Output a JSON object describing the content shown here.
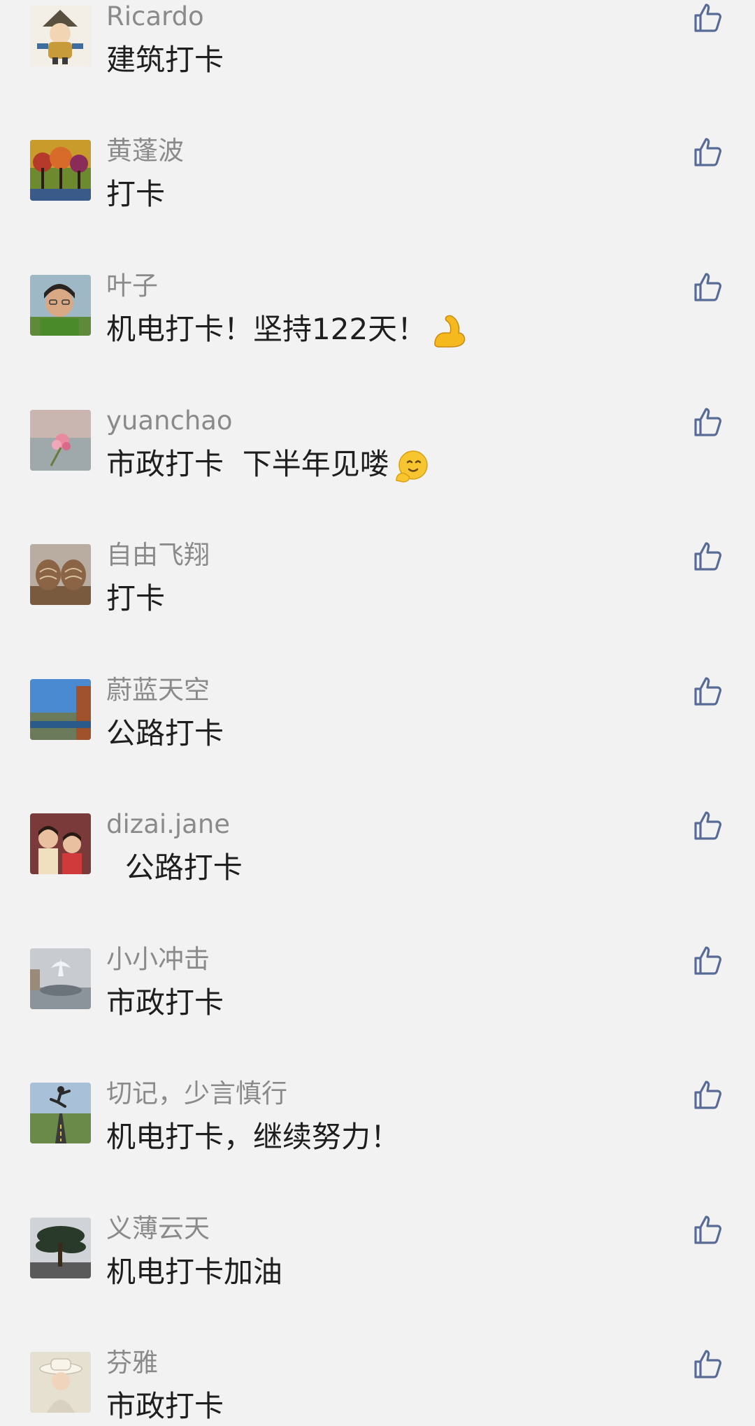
{
  "comments": [
    {
      "username": "Ricardo",
      "content": "建筑打卡",
      "avatar": "cartoon-character-avatar",
      "emoji": ""
    },
    {
      "username": "黄蓬波",
      "content": "打卡",
      "avatar": "painting-trees-avatar",
      "emoji": ""
    },
    {
      "username": "叶子",
      "content": "机电打卡！坚持122天！",
      "avatar": "woman-portrait-avatar",
      "emoji": "flexed-biceps-emoji"
    },
    {
      "username": "yuanchao",
      "content": "市政打卡  下半年见喽",
      "avatar": "flowers-sea-avatar",
      "emoji": "smiling-face-emoji"
    },
    {
      "username": "自由飞翔",
      "content": "打卡",
      "avatar": "walnuts-avatar",
      "emoji": ""
    },
    {
      "username": "蔚蓝天空",
      "content": "公路打卡",
      "avatar": "blue-sky-avatar",
      "emoji": ""
    },
    {
      "username": "dizai.jane",
      "content": "  公路打卡",
      "avatar": "children-photo-avatar",
      "emoji": ""
    },
    {
      "username": "小小冲击",
      "content": "市政打卡",
      "avatar": "fountain-avatar",
      "emoji": ""
    },
    {
      "username": "切记，少言慎行",
      "content": "机电打卡，继续努力！",
      "avatar": "jumping-person-road-avatar",
      "emoji": ""
    },
    {
      "username": "义薄云天",
      "content": "机电打卡加油",
      "avatar": "pine-tree-avatar",
      "emoji": ""
    },
    {
      "username": "芬雅",
      "content": "市政打卡",
      "avatar": "woman-hat-avatar",
      "emoji": ""
    }
  ],
  "icons": {
    "like": "thumbs-up-icon"
  },
  "colors": {
    "background": "#f2f2f2",
    "username": "#8a8a8a",
    "content": "#1e1e1e",
    "like_icon": "#586b96"
  }
}
